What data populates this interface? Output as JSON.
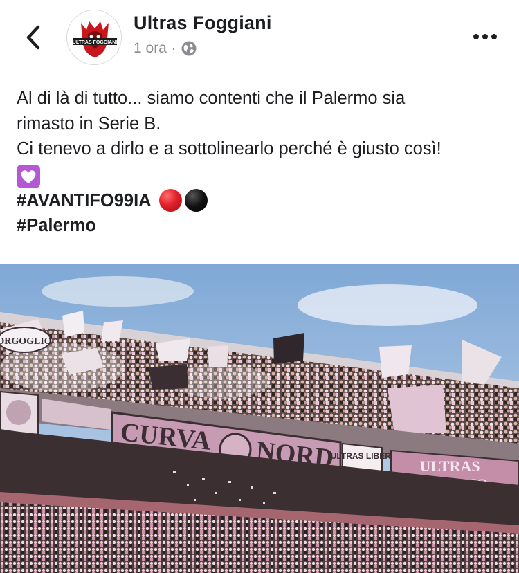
{
  "header": {
    "page_name": "Ultras Foggiani",
    "timestamp": "1 ora",
    "separator": "·",
    "privacy_icon": "globe-icon",
    "back_icon": "chevron-left-icon",
    "more_icon": "more-horizontal-icon",
    "avatar_text": "ULTRAS FOGGIANI"
  },
  "post": {
    "lines": [
      "Al di là di tutto... siamo contenti che il Palermo sia",
      "rimasto in Serie B.",
      "Ci tenevo a dirlo e a sottolinearlo perché è giusto così!"
    ],
    "emoji": "purple-heart-icon",
    "hashtags": [
      "#AVANTIFO99IA",
      "#Palermo"
    ],
    "ball_colors": [
      "#e0202a",
      "#111111"
    ]
  },
  "photo": {
    "banners": {
      "curva": "CURVA",
      "nord": "NORD",
      "ultras_liberi": "ULTRAS LIBERI",
      "ultras_palermo_1": "ULTRAS",
      "ultras_palermo_2": "PALERMO",
      "orgoglio": "ORGOGLIO"
    }
  },
  "colors": {
    "text": "#1c1e21",
    "secondary": "#8a8d91",
    "accent_pink": "#c78fb0"
  }
}
